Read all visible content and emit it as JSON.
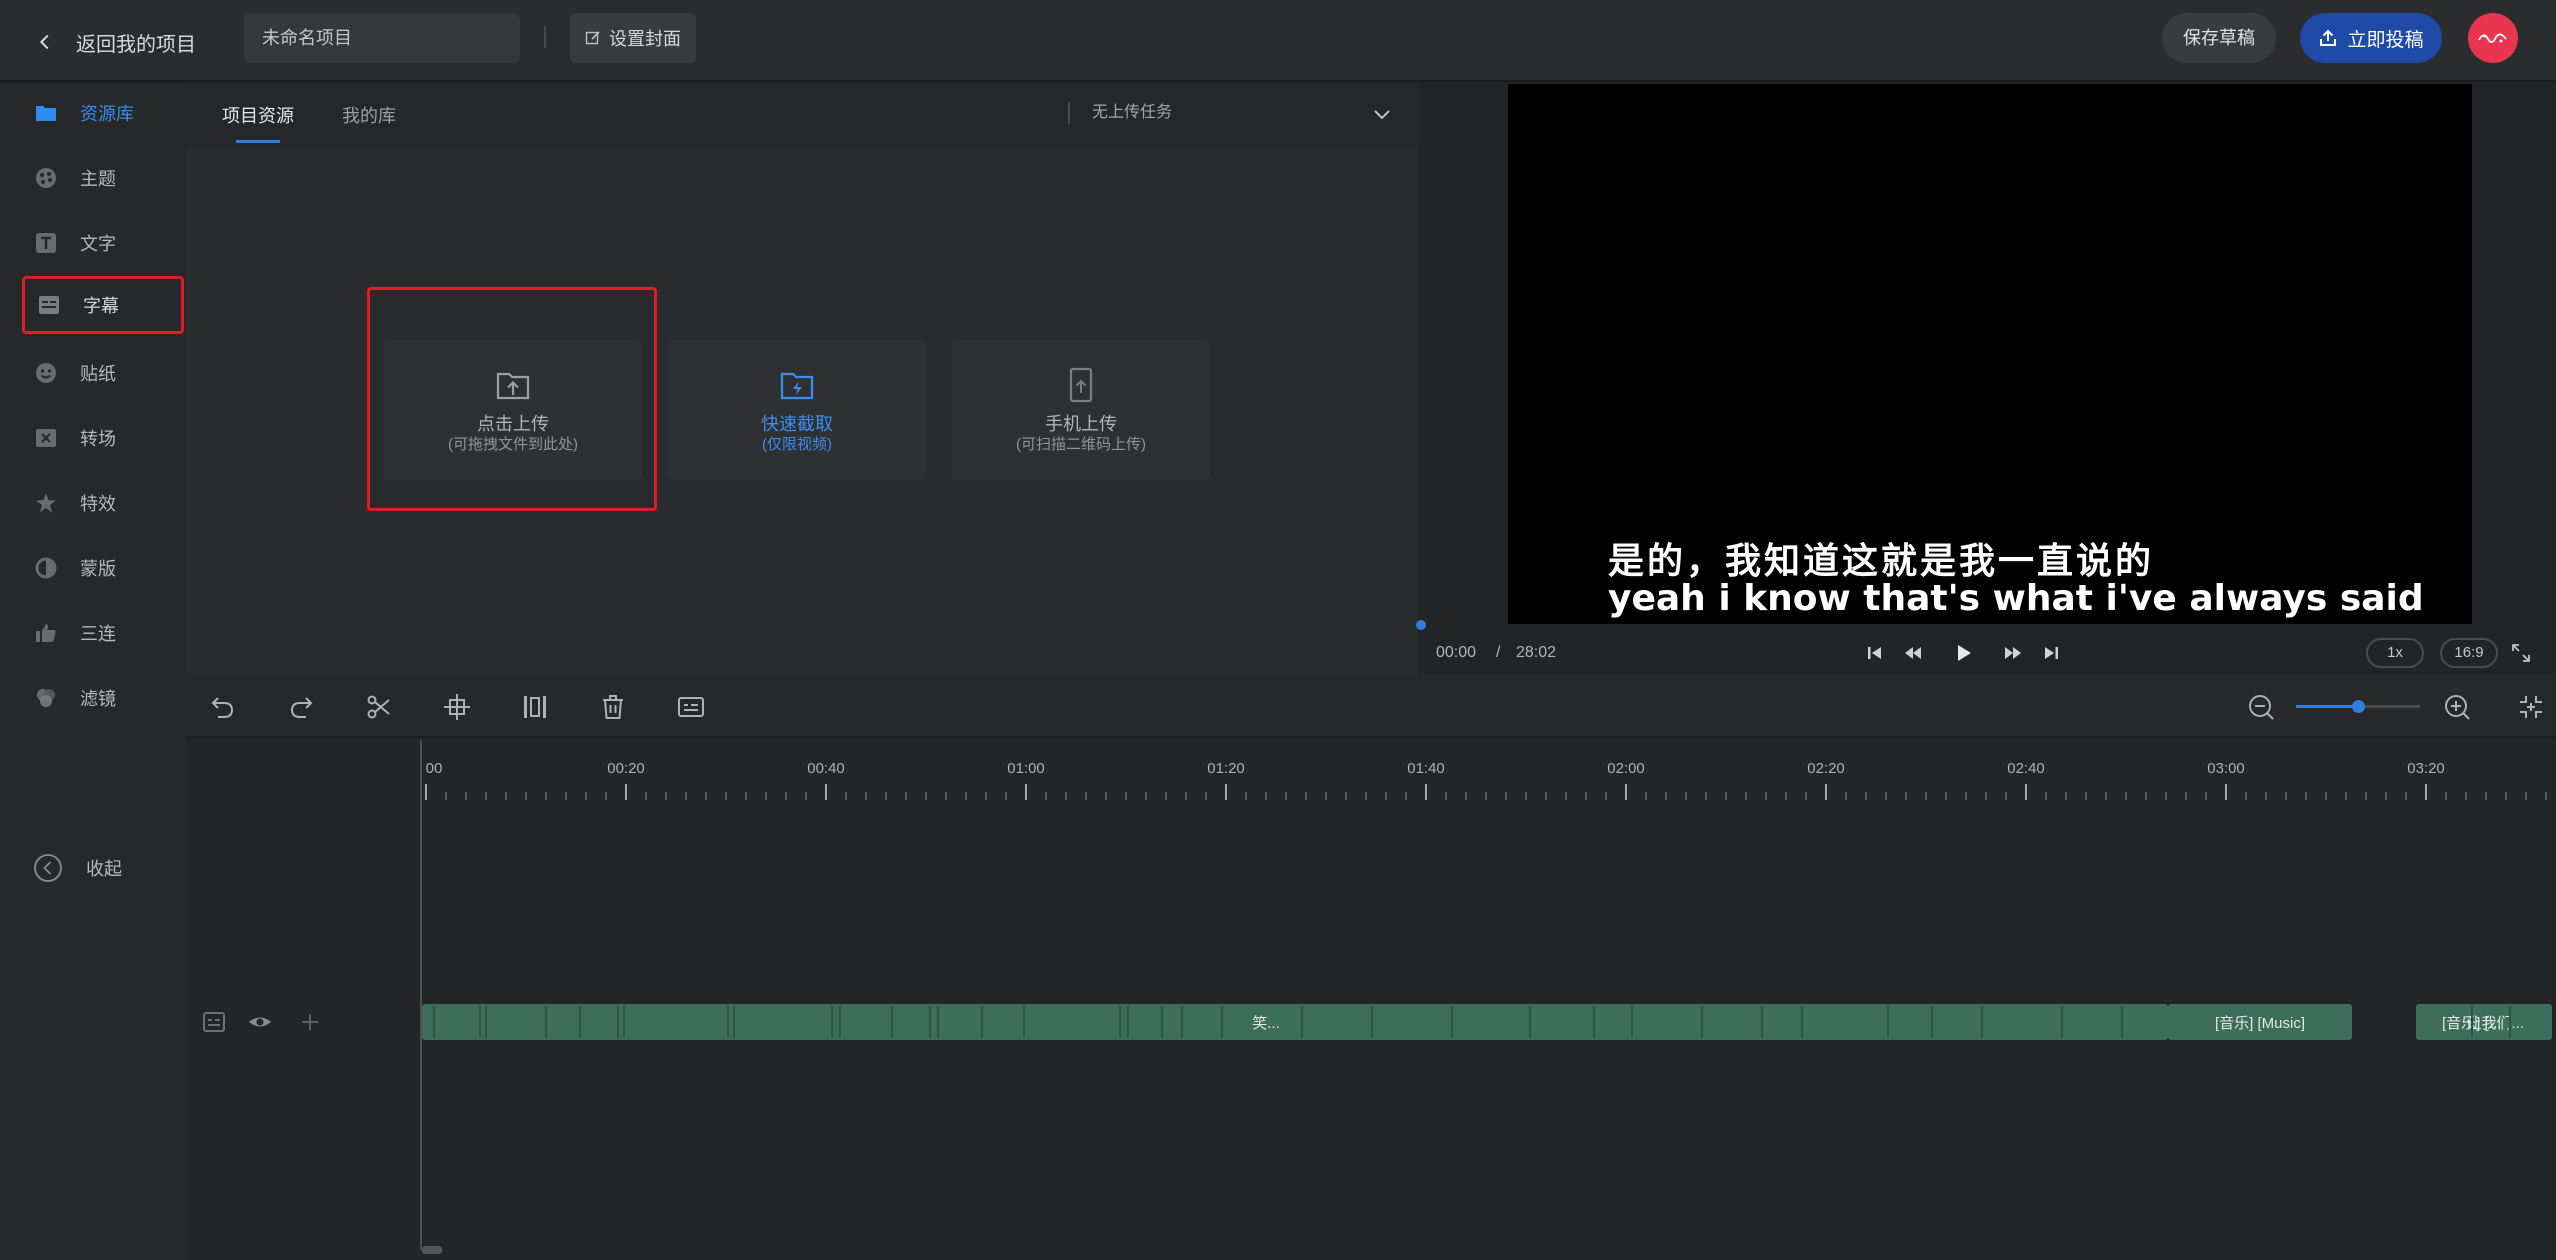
{
  "header": {
    "back_label": "返回我的项目",
    "project_name": "未命名项目",
    "cover_label": "设置封面",
    "save_label": "保存草稿",
    "submit_label": "立即投稿"
  },
  "sidebar": {
    "items": [
      {
        "label": "资源库",
        "icon": "folder-icon"
      },
      {
        "label": "主题",
        "icon": "theme-icon"
      },
      {
        "label": "文字",
        "icon": "text-icon"
      },
      {
        "label": "字幕",
        "icon": "subtitle-icon"
      },
      {
        "label": "贴纸",
        "icon": "sticker-icon"
      },
      {
        "label": "转场",
        "icon": "transition-icon"
      },
      {
        "label": "特效",
        "icon": "effect-icon"
      },
      {
        "label": "蒙版",
        "icon": "mask-icon"
      },
      {
        "label": "三连",
        "icon": "thumbs-up-icon"
      },
      {
        "label": "滤镜",
        "icon": "filter-icon"
      }
    ],
    "collapse_label": "收起"
  },
  "resources": {
    "tabs": [
      "项目资源",
      "我的库"
    ],
    "upload_status": "无上传任务",
    "cards": [
      {
        "title": "点击上传",
        "sub": "(可拖拽文件到此处)"
      },
      {
        "title": "快速截取",
        "sub": "(仅限视频)"
      },
      {
        "title": "手机上传",
        "sub": "(可扫描二维码上传)"
      }
    ]
  },
  "preview": {
    "subtitle_zh": "是的，我知道这就是我一直说的",
    "subtitle_en": "yeah i know that's what i've always said",
    "time_current": "00:00",
    "time_sep": "/",
    "time_total": "28:02",
    "speed": "1x",
    "ratio": "16:9"
  },
  "timeline": {
    "ticks": [
      "00",
      "00:20",
      "00:40",
      "01:00",
      "01:20",
      "01:40",
      "02:00",
      "02:20",
      "02:40",
      "03:00",
      "03:20"
    ],
    "clips": [
      "笑...",
      "[音乐] [Music]",
      "[音乐] [...",
      "让我们..."
    ]
  },
  "colors": {
    "accent": "#2f7de1",
    "submit": "#1f4aa8",
    "highlight_box": "#e01b24",
    "clip": "#3d6d5b"
  }
}
